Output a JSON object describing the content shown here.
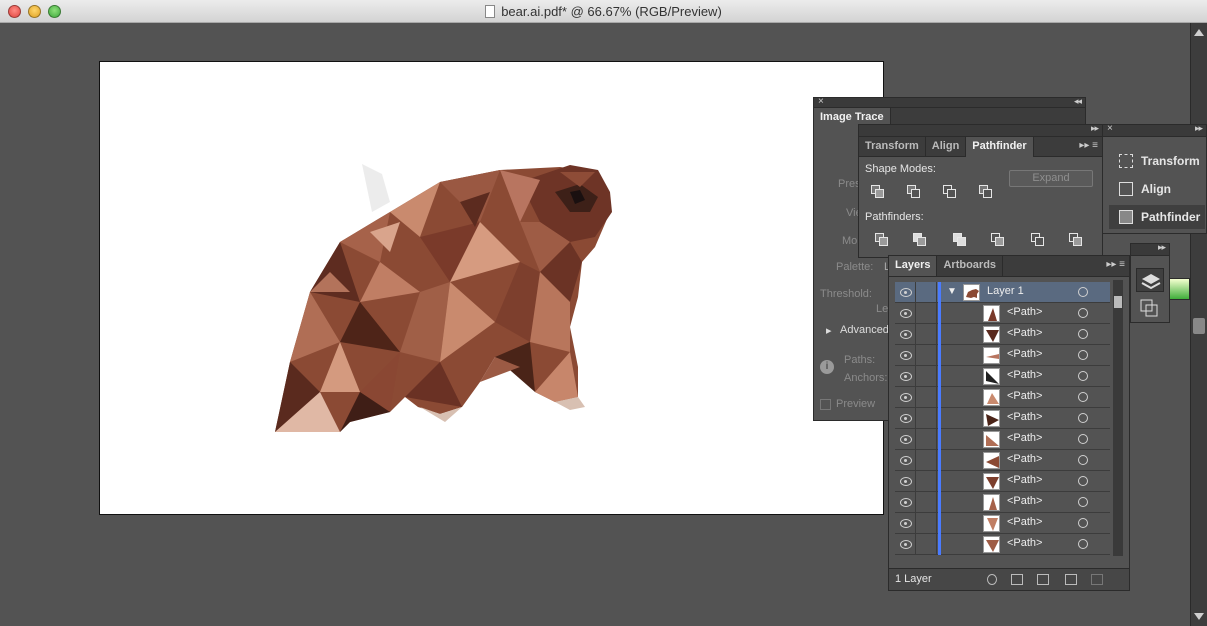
{
  "window": {
    "title": "bear.ai.pdf* @ 66.67% (RGB/Preview)"
  },
  "image_trace": {
    "title": "Image Trace",
    "labels": {
      "preset": "Pres",
      "view": "Vie",
      "mode": "Mo",
      "palette": "Palette:",
      "palette_value": "L",
      "threshold": "Threshold:",
      "less": "Les",
      "advanced": "Advanced",
      "paths": "Paths:",
      "anchors": "Anchors:",
      "preview": "Preview"
    }
  },
  "pathfinder_panel": {
    "tabs": [
      "Transform",
      "Align",
      "Pathfinder"
    ],
    "active_tab": "Pathfinder",
    "shape_modes_label": "Shape Modes:",
    "pathfinders_label": "Pathfinders:",
    "expand_label": "Expand"
  },
  "layers_panel": {
    "tabs": [
      "Layers",
      "Artboards"
    ],
    "active_tab": "Layers",
    "top_layer": "Layer 1",
    "items": [
      "<Path>",
      "<Path>",
      "<Path>",
      "<Path>",
      "<Path>",
      "<Path>",
      "<Path>",
      "<Path>",
      "<Path>",
      "<Path>",
      "<Path>",
      "<Path>"
    ],
    "footer_count": "1 Layer"
  },
  "dock": {
    "items": [
      "Transform",
      "Align",
      "Pathfinder"
    ],
    "selected": "Pathfinder"
  },
  "colors": {
    "bear_dark": "#4a2418",
    "bear_mid": "#8b4a34",
    "bear_light": "#c98a6e",
    "layer_color": "#4a7bff"
  }
}
